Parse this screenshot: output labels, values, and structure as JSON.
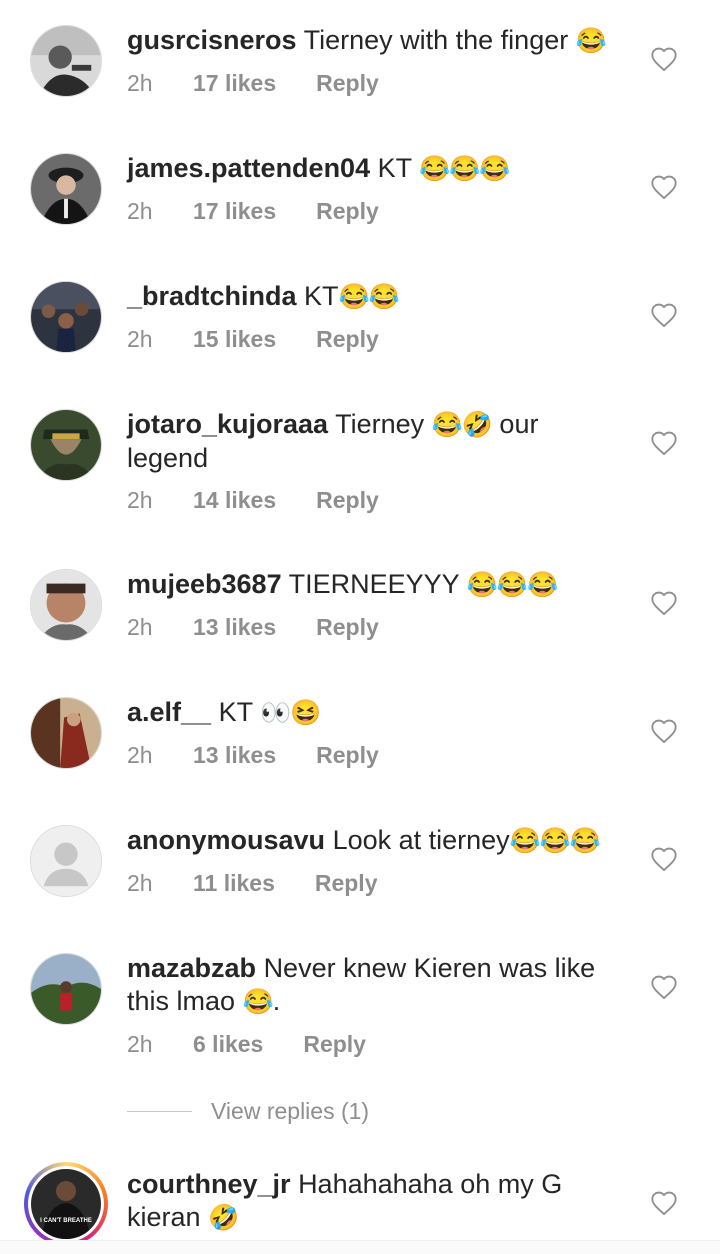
{
  "comments": [
    {
      "user": "gusrcisneros",
      "text": "Tierney with the finger",
      "emoji": "😂",
      "time": "2h",
      "likes": "17 likes",
      "reply": "Reply"
    },
    {
      "user": "james.pattenden04",
      "text": "KT",
      "emoji": "😂😂😂",
      "time": "2h",
      "likes": "17 likes",
      "reply": "Reply"
    },
    {
      "user": "_bradtchinda",
      "text": "KT",
      "emoji": "😂😂",
      "time": "2h",
      "likes": "15 likes",
      "reply": "Reply"
    },
    {
      "user": "jotaro_kujoraaa",
      "text": "Tierney",
      "emoji": "😂🤣",
      "text2": "our legend",
      "time": "2h",
      "likes": "14 likes",
      "reply": "Reply"
    },
    {
      "user": "mujeeb3687",
      "text": "TIERNEEYYY",
      "emoji": "😂😂😂",
      "time": "2h",
      "likes": "13 likes",
      "reply": "Reply"
    },
    {
      "user": "a.elf__",
      "text": "KT",
      "emoji": "👀😆",
      "time": "2h",
      "likes": "13 likes",
      "reply": "Reply"
    },
    {
      "user": "anonymousavu",
      "text": "Look at tierney",
      "emoji": "😂😂😂",
      "time": "2h",
      "likes": "11 likes",
      "reply": "Reply"
    },
    {
      "user": "mazabzab",
      "text": "Never knew Kieren was like this lmao",
      "emoji": "😂",
      "text2": ".",
      "time": "2h",
      "likes": "6 likes",
      "reply": "Reply"
    },
    {
      "user": "courthney_jr",
      "text": "Hahahahaha oh my G kieran",
      "emoji": "🤣"
    }
  ],
  "view_replies": "View replies (1)",
  "avatar_badge_text": "I CAN'T BREATHE",
  "icons": {
    "like": "heart-outline-icon"
  },
  "colors": {
    "text": "#262626",
    "secondary": "#8e8e8e",
    "divider": "#c7c7c7"
  }
}
